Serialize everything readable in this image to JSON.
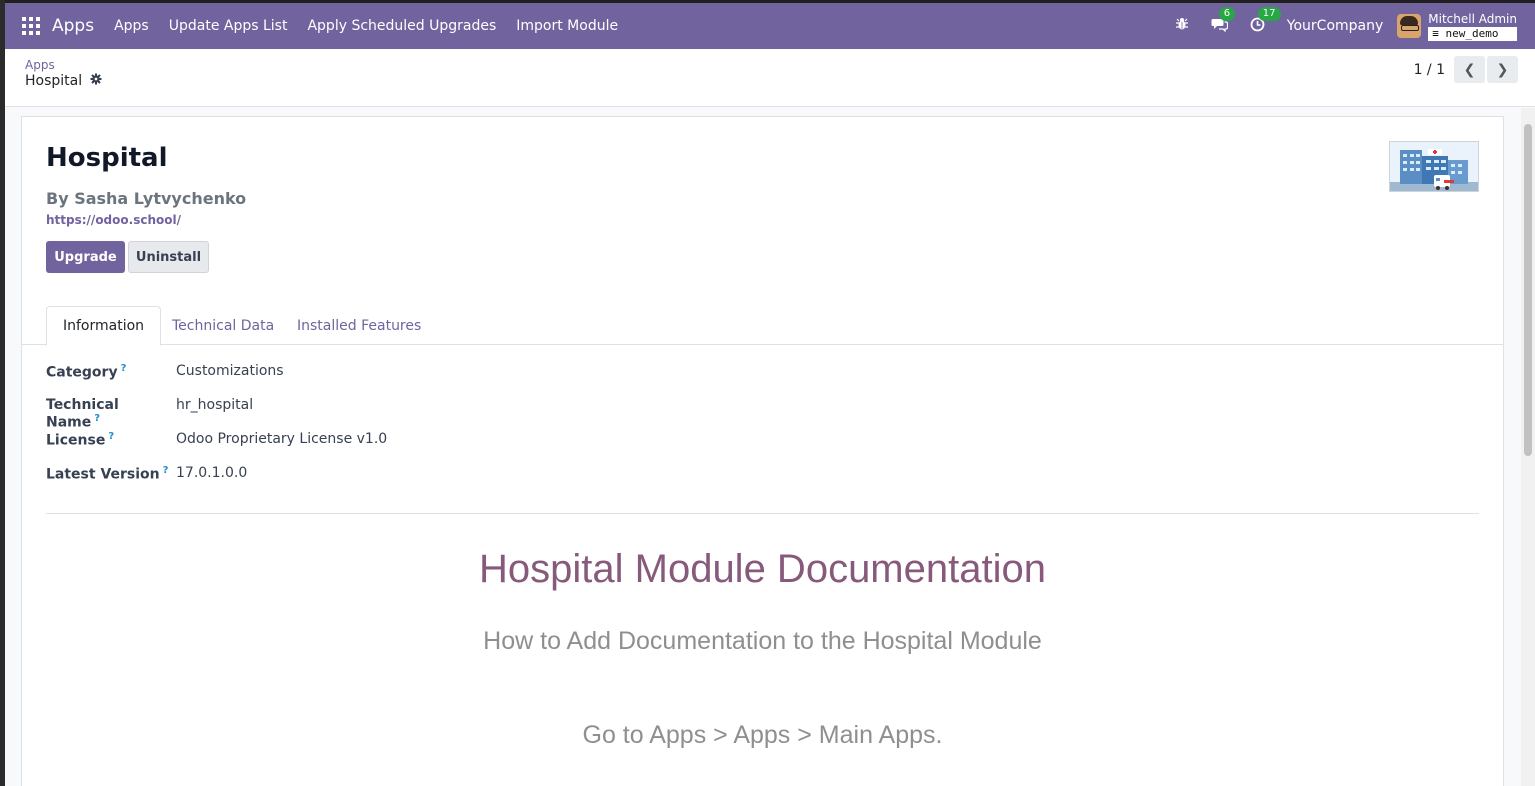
{
  "navbar": {
    "brand": "Apps",
    "menu": [
      "Apps",
      "Update Apps List",
      "Apply Scheduled Upgrades",
      "Import Module"
    ],
    "messages_count": "6",
    "activities_count": "17",
    "company": "YourCompany",
    "user_name": "Mitchell Admin",
    "database": "new_demo",
    "color": "#71639e"
  },
  "breadcrumb": {
    "parent": "Apps",
    "current": "Hospital"
  },
  "pager": {
    "value": "1 / 1"
  },
  "module": {
    "name": "Hospital",
    "author": "By Sasha Lytvychenko",
    "website": "https://odoo.school/",
    "upgrade_label": "Upgrade",
    "uninstall_label": "Uninstall"
  },
  "tabs": [
    "Information",
    "Technical Data",
    "Installed Features"
  ],
  "fields": [
    {
      "label": "Category",
      "value": "Customizations"
    },
    {
      "label": "Technical Name",
      "value": "hr_hospital"
    },
    {
      "label": "License",
      "value": "Odoo Proprietary License v1.0"
    },
    {
      "label": "Latest Version",
      "value": "17.0.1.0.0"
    }
  ],
  "documentation": {
    "heading": "Hospital Module Documentation",
    "subheading": "How to Add Documentation to the Hospital Module",
    "paragraph": "Go to Apps > Apps > Main Apps."
  }
}
